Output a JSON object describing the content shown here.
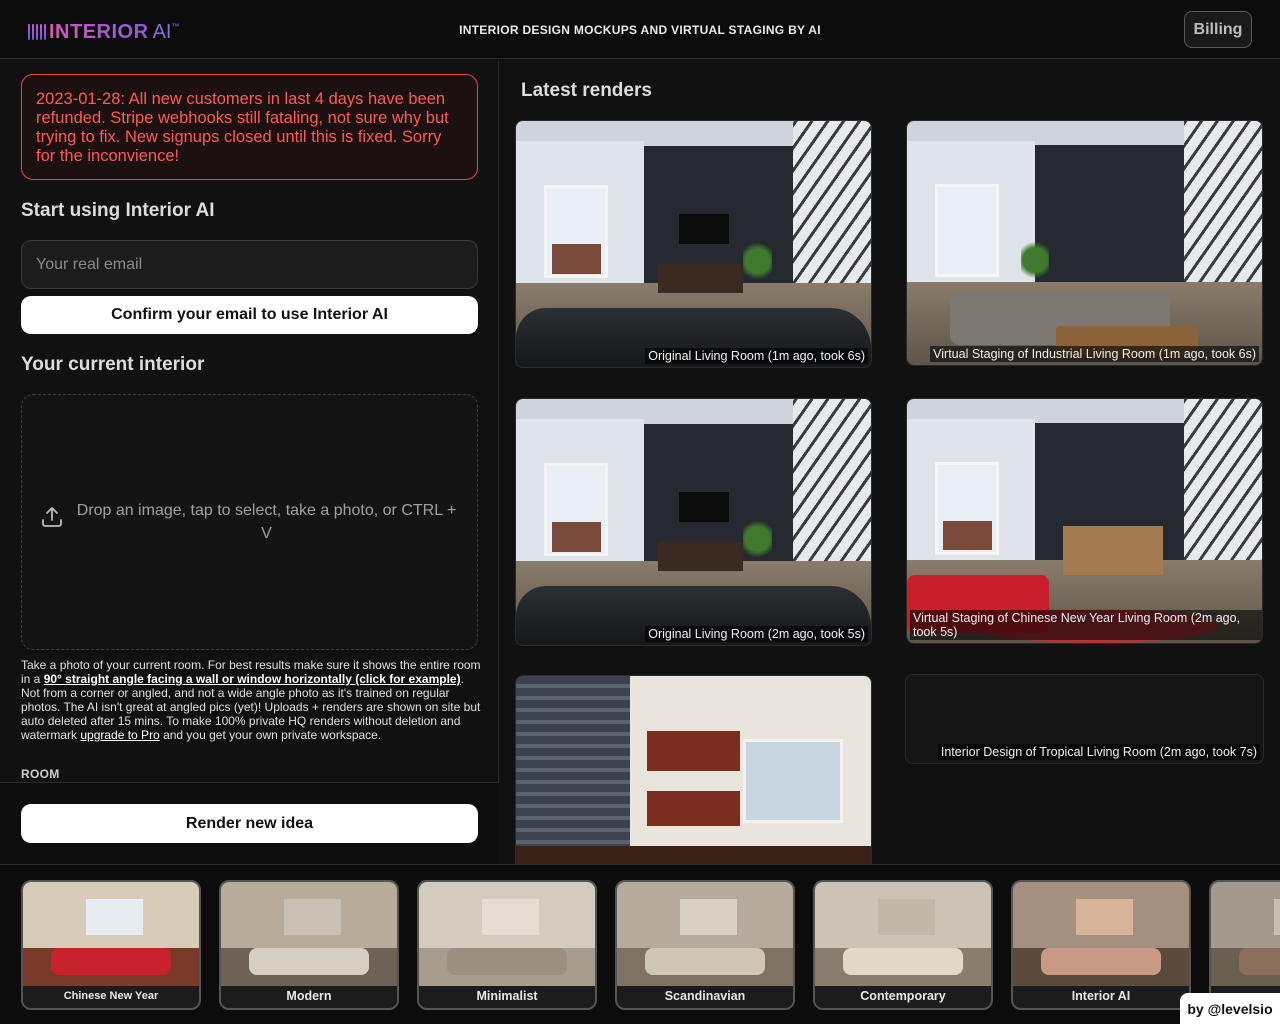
{
  "header": {
    "logo_word": "INTERIOR",
    "logo_ai": "AI",
    "logo_tm": "™",
    "tagline": "INTERIOR DESIGN MOCKUPS AND VIRTUAL STAGING BY AI",
    "billing_label": "Billing"
  },
  "alert": {
    "text": "2023-01-28: All new customers in last 4 days have been refunded. Stripe webhooks still fataling, not sure why but trying to fix. New signups closed until this is fixed. Sorry for the inconvience!"
  },
  "signup": {
    "title": "Start using Interior AI",
    "email_placeholder": "Your real email",
    "confirm_label": "Confirm your email to use Interior AI"
  },
  "upload": {
    "title": "Your current interior",
    "dropzone_text": "Drop an image, tap to select, take a photo, or CTRL + V",
    "help_prefix": "Take a photo of your current room. For best results make sure it shows the entire room in a ",
    "help_link_angle": "90° straight angle facing a wall or window horizontally (click for example)",
    "help_middle": ". Not from a corner or angled, and not a wide angle photo as it's trained on regular photos. The AI isn't great at angled pics (yet)! Uploads + renders are shown on site but auto deleted after 15 mins. To make 100% private HQ renders without deletion and watermark ",
    "help_link_pro": "upgrade to Pro",
    "help_suffix": " and you get your own private workspace.",
    "room_label": "ROOM",
    "render_label": "Render new idea"
  },
  "latest": {
    "title": "Latest renders",
    "renders": [
      {
        "caption": "Original Living Room (1m ago, took 6s)"
      },
      {
        "caption": "Virtual Staging of Industrial Living Room (1m ago, took 6s)"
      },
      {
        "caption": "Original Living Room (2m ago, took 5s)"
      },
      {
        "caption": "Virtual Staging of Chinese New Year Living Room (2m ago, took 5s)"
      },
      {
        "caption": ""
      },
      {
        "caption": "Interior Design of Tropical Living Room (2m ago, took 7s)"
      }
    ]
  },
  "styles": [
    {
      "label": "Chinese New Year",
      "wall": "#d8cbb8",
      "floor": "#7a3a2a",
      "sofa": "#c8222c",
      "win": "#e7ecf1"
    },
    {
      "label": "Modern",
      "wall": "#b9ab9a",
      "floor": "#6e6256",
      "sofa": "#d6cec2",
      "win": "#c8c0b4"
    },
    {
      "label": "Minimalist",
      "wall": "#d3cbc0",
      "floor": "#a89c8e",
      "sofa": "#9c8f80",
      "win": "#e3ddd4"
    },
    {
      "label": "Scandinavian",
      "wall": "#b5aa9c",
      "floor": "#7f7265",
      "sofa": "#d0c6b8",
      "win": "#d8d0c4"
    },
    {
      "label": "Contemporary",
      "wall": "#ccc3b6",
      "floor": "#8a7c6e",
      "sofa": "#e2d8c9",
      "win": "#c2b8aa"
    },
    {
      "label": "Interior AI",
      "wall": "#a58f7e",
      "floor": "#5c4a3d",
      "sofa": "#c99b86",
      "win": "#d7b49a"
    },
    {
      "label": "",
      "wall": "#a39a8d",
      "floor": "#6b5f52",
      "sofa": "#8a6d5a",
      "win": "#c7bfb2"
    }
  ],
  "credit": "by @levelsio"
}
